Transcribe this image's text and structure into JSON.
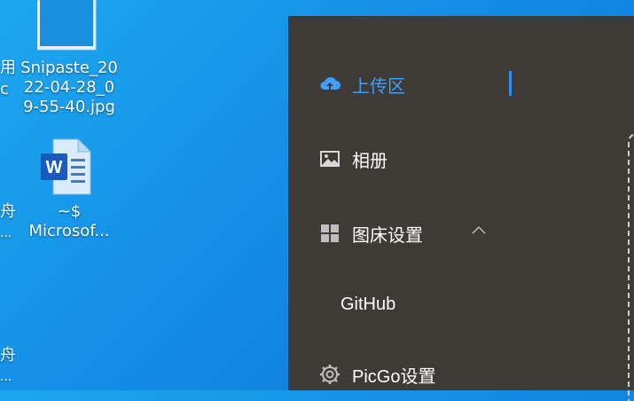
{
  "desktop": {
    "left_fragments": [
      "用",
      "c",
      "舟",
      "...",
      "舟",
      "..."
    ],
    "items": [
      {
        "label": "Snipaste_20\n22-04-28_0\n9-55-40.jpg",
        "icon": "image-file-icon"
      },
      {
        "label": "~$\nMicrosof...",
        "icon": "word-document-icon"
      }
    ]
  },
  "app": {
    "menu": [
      {
        "label": "上传区",
        "icon": "cloud-upload-icon",
        "active": true
      },
      {
        "label": "相册",
        "icon": "image-icon"
      },
      {
        "label": "图床设置",
        "icon": "grid-icon",
        "expanded": true
      },
      {
        "label": "GitHub"
      },
      {
        "label": "PicGo设置",
        "icon": "gear-icon"
      }
    ],
    "accent": "#409eff",
    "background": "#3e3b37"
  }
}
